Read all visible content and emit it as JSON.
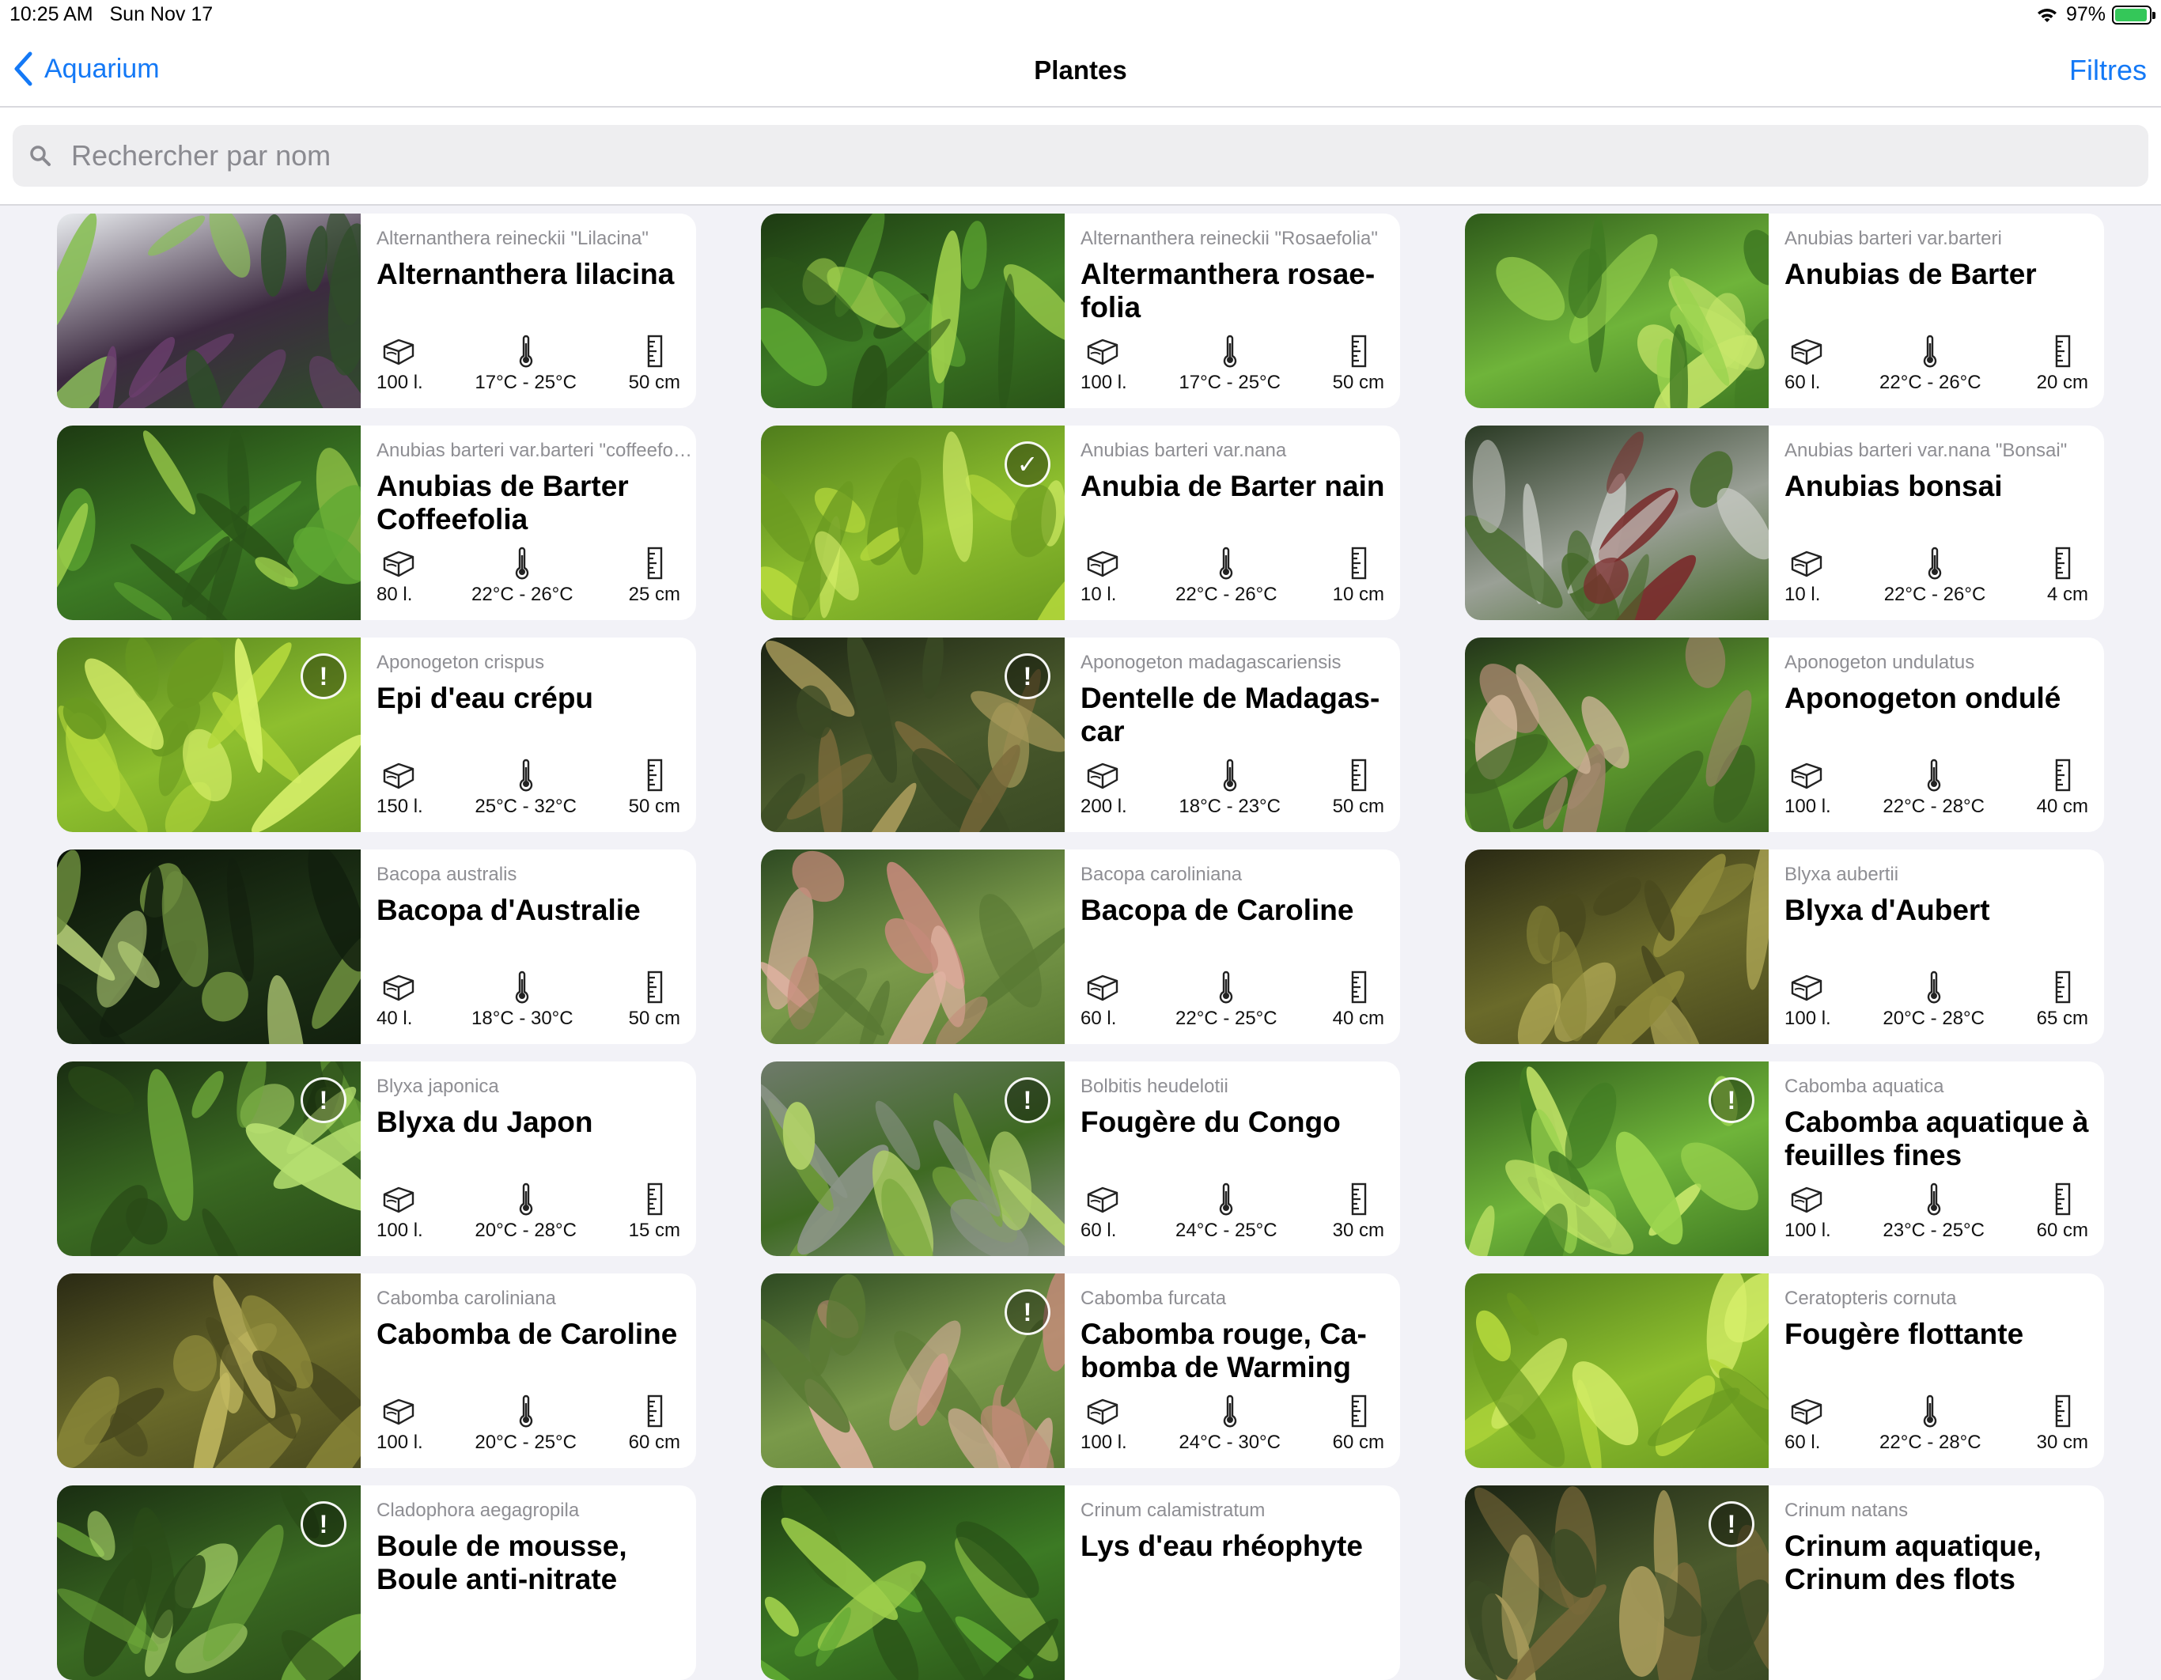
{
  "status": {
    "time": "10:25 AM",
    "date": "Sun Nov 17",
    "battery": "97%"
  },
  "nav": {
    "back_label": "Aquarium",
    "title": "Plantes",
    "filters_label": "Filtres"
  },
  "search": {
    "placeholder": "Rechercher par nom",
    "value": ""
  },
  "plants": [
    {
      "sci": "Alternanthera reineckii \"Lilacina\"",
      "name": "Alternanthera lilacina",
      "volume": "100 l.",
      "temp": "17°C - 25°C",
      "height": "50 cm",
      "badge": "",
      "theme": "purple"
    },
    {
      "sci": "Alternanthera reineckii \"Rosaefolia\"",
      "name": "Altermanthera rosae­folia",
      "volume": "100 l.",
      "temp": "17°C - 25°C",
      "height": "50 cm",
      "badge": "",
      "theme": "green"
    },
    {
      "sci": "Anubias barteri var.barteri",
      "name": "Anubias de Barter",
      "volume": "60 l.",
      "temp": "22°C - 26°C",
      "height": "20 cm",
      "badge": "",
      "theme": "bright"
    },
    {
      "sci": "Anubias barteri var.barteri \"coffeefolia\"",
      "name": "Anubias de Barter Coffeefolia",
      "volume": "80 l.",
      "temp": "22°C - 26°C",
      "height": "25 cm",
      "badge": "",
      "theme": "green"
    },
    {
      "sci": "Anubias barteri var.nana",
      "name": "Anubia de Barter nain",
      "volume": "10 l.",
      "temp": "22°C - 26°C",
      "height": "10 cm",
      "badge": "✓",
      "theme": "lime"
    },
    {
      "sci": "Anubias barteri var.nana \"Bonsai\"",
      "name": "Anubias bonsai",
      "volume": "10 l.",
      "temp": "22°C - 26°C",
      "height": "4 cm",
      "badge": "",
      "theme": "rock"
    },
    {
      "sci": "Aponogeton crispus",
      "name": "Epi d'eau crépu",
      "volume": "150 l.",
      "temp": "25°C - 32°C",
      "height": "50 cm",
      "badge": "!",
      "theme": "lime"
    },
    {
      "sci": "Aponogeton madagascariensis",
      "name": "Dentelle de Madagas­car",
      "volume": "200 l.",
      "temp": "18°C - 23°C",
      "height": "50 cm",
      "badge": "!",
      "theme": "dark"
    },
    {
      "sci": "Aponogeton undulatus",
      "name": "Aponogeton ondulé",
      "volume": "100 l.",
      "temp": "22°C - 28°C",
      "height": "40 cm",
      "badge": "",
      "theme": "gravel"
    },
    {
      "sci": "Bacopa australis",
      "name": "Bacopa d'Australie",
      "volume": "40 l.",
      "temp": "18°C - 30°C",
      "height": "50 cm",
      "badge": "",
      "theme": "night"
    },
    {
      "sci": "Bacopa caroliniana",
      "name": "Bacopa de Caroline",
      "volume": "60 l.",
      "temp": "22°C - 25°C",
      "height": "40 cm",
      "badge": "",
      "theme": "pink"
    },
    {
      "sci": "Blyxa aubertii",
      "name": "Blyxa d'Aubert",
      "volume": "100 l.",
      "temp": "20°C - 28°C",
      "height": "65 cm",
      "badge": "",
      "theme": "olive"
    },
    {
      "sci": "Blyxa japonica",
      "name": "Blyxa du Japon",
      "volume": "100 l.",
      "temp": "20°C - 28°C",
      "height": "15 cm",
      "badge": "!",
      "theme": "grass"
    },
    {
      "sci": "Bolbitis heudelotii",
      "name": "Fougère du Congo",
      "volume": "60 l.",
      "temp": "24°C - 25°C",
      "height": "30 cm",
      "badge": "!",
      "theme": "fern"
    },
    {
      "sci": "Cabomba aquatica",
      "name": "Cabomba aquatique à feuilles fines",
      "volume": "100 l.",
      "temp": "23°C - 25°C",
      "height": "60 cm",
      "badge": "!",
      "theme": "bright"
    },
    {
      "sci": "Cabomba caroliniana",
      "name": "Cabomba de Caroline",
      "volume": "100 l.",
      "temp": "20°C - 25°C",
      "height": "60 cm",
      "badge": "",
      "theme": "olive"
    },
    {
      "sci": "Cabomba furcata",
      "name": "Cabomba rouge, Ca­bomba de Warming",
      "volume": "100 l.",
      "temp": "24°C - 30°C",
      "height": "60 cm",
      "badge": "!",
      "theme": "pink"
    },
    {
      "sci": "Ceratopteris cornuta",
      "name": "Fougère flottante",
      "volume": "60 l.",
      "temp": "22°C - 28°C",
      "height": "30 cm",
      "badge": "",
      "theme": "lime"
    },
    {
      "sci": "Cladophora aegagropila",
      "name": "Boule de mousse, Boule anti-nitrate",
      "volume": "",
      "temp": "",
      "height": "",
      "badge": "!",
      "theme": "grass"
    },
    {
      "sci": "Crinum calamistratum",
      "name": "Lys d'eau rhéophyte",
      "volume": "",
      "temp": "",
      "height": "",
      "badge": "",
      "theme": "green"
    },
    {
      "sci": "Crinum natans",
      "name": "Crinum aquatique, Crinum des flots",
      "volume": "",
      "temp": "",
      "height": "",
      "badge": "!",
      "theme": "dark"
    }
  ],
  "icons": {
    "volume": "aquarium-volume-icon",
    "temp": "thermometer-icon",
    "height": "ruler-icon",
    "search": "search-icon",
    "back": "chevron-left-icon"
  },
  "colors": {
    "accent": "#1479f6"
  }
}
